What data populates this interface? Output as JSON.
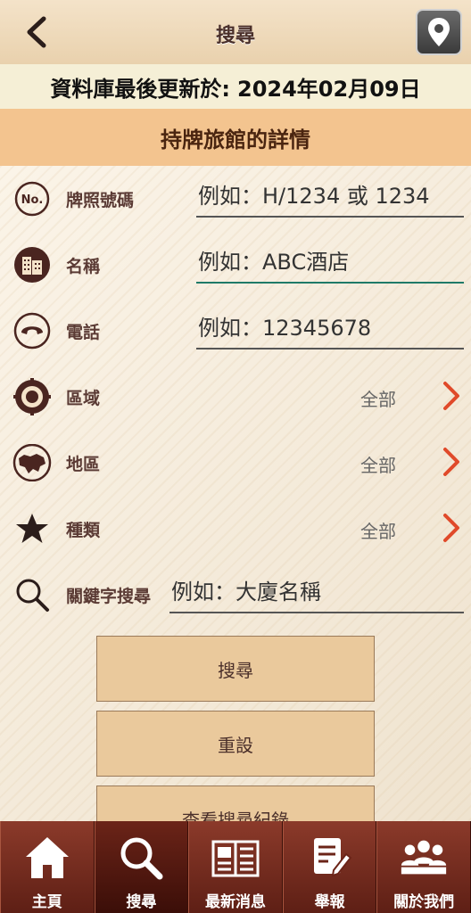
{
  "header": {
    "title": "搜尋"
  },
  "update_bar": {
    "label": "資料庫最後更新於:",
    "date": "2024年02月09日"
  },
  "section_title": "持牌旅館的詳情",
  "form": {
    "license": {
      "label": "牌照號碼",
      "placeholder": "例如：H/1234 或 1234",
      "icon": "no-badge-icon"
    },
    "name": {
      "label": "名稱",
      "placeholder": "例如：ABC酒店",
      "icon": "building-icon"
    },
    "phone": {
      "label": "電話",
      "placeholder": "例如：12345678",
      "icon": "phone-icon"
    },
    "zone": {
      "label": "區域",
      "value": "全部",
      "icon": "target-icon"
    },
    "district": {
      "label": "地區",
      "value": "全部",
      "icon": "map-region-icon"
    },
    "type": {
      "label": "種類",
      "value": "全部",
      "icon": "star-icon"
    },
    "keyword": {
      "label": "關鍵字搜尋",
      "placeholder": "例如：大廈名稱",
      "icon": "search-icon"
    }
  },
  "buttons": {
    "search": "搜尋",
    "reset": "重設",
    "history": "查看搜尋紀錄"
  },
  "nav": [
    {
      "label": "主頁",
      "icon": "home-icon"
    },
    {
      "label": "搜尋",
      "icon": "search-icon"
    },
    {
      "label": "最新消息",
      "icon": "news-icon"
    },
    {
      "label": "舉報",
      "icon": "report-icon"
    },
    {
      "label": "關於我們",
      "icon": "about-icon"
    }
  ],
  "colors": {
    "header_bg": "#f4e3c9",
    "section_bg": "#f3c48f",
    "accent_chevron": "#e04a2a",
    "input_active": "#1f7a68",
    "nav_bg": "#8b3a2a",
    "button_bg": "#eac99c"
  }
}
